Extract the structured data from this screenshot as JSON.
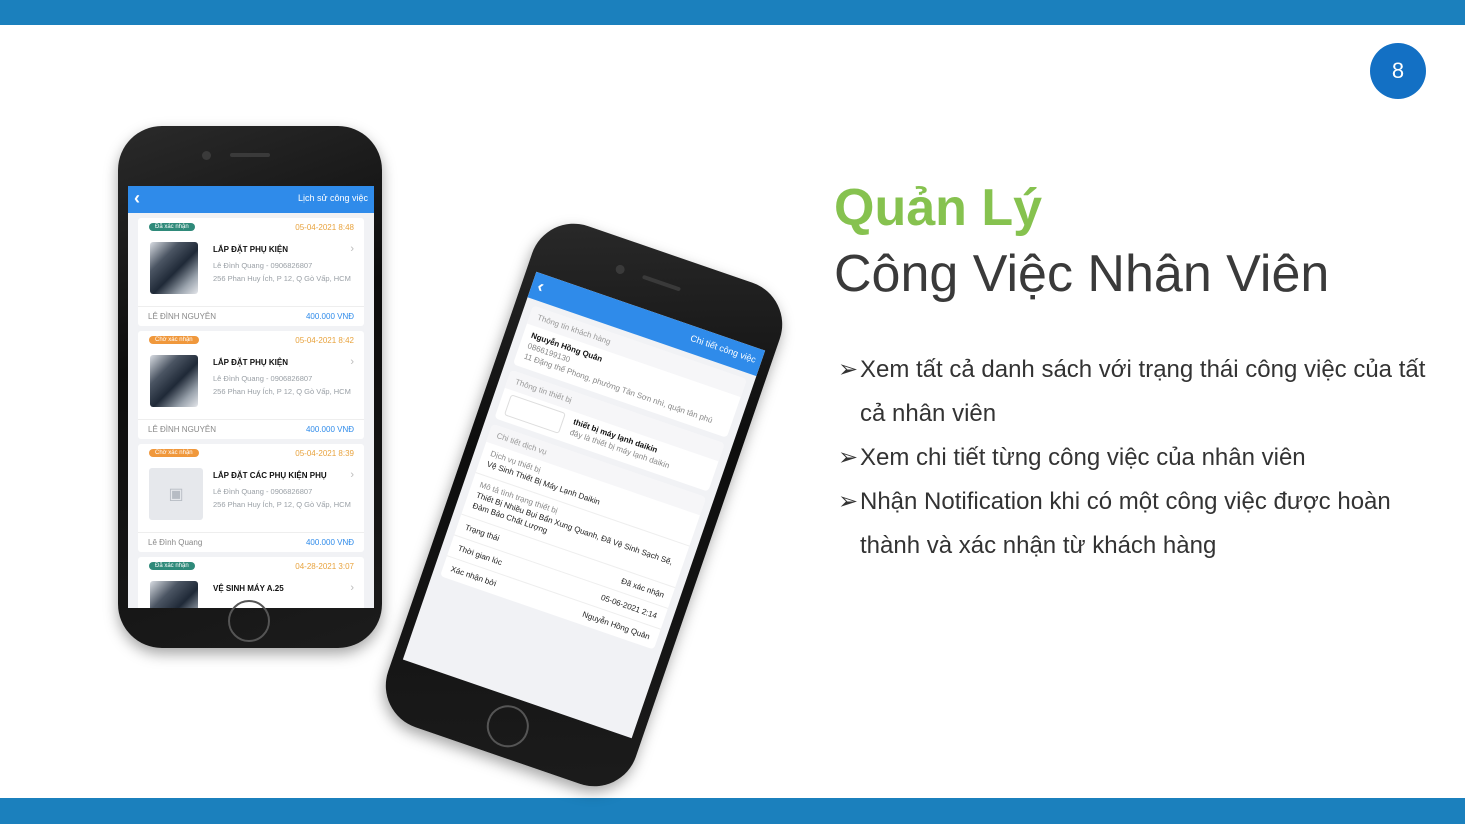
{
  "page_number": "8",
  "title": {
    "line1": "Quản Lý",
    "line2": "Công Việc Nhân Viên"
  },
  "bullets": [
    "Xem tất cả danh sách với trạng thái công việc của tất cả nhân viên",
    "Xem chi tiết từng công việc của nhân viên",
    "Nhận Notification khi có một công việc được hoàn thành và xác nhận từ khách hàng"
  ],
  "colors": {
    "band": "#1b80bd",
    "badge_circle": "#1370c4",
    "title_green": "#86c24f",
    "app_blue": "#2f8bea"
  },
  "phone1": {
    "nav_title": "Lịch sử công việc",
    "back_icon": "chevron-left-icon",
    "jobs": [
      {
        "status": "Đã xác nhận",
        "date": "05-04-2021 8:48",
        "title": "LẮP ĐẶT PHỤ KIỆN",
        "contact": "Lê Đình Quang - 0906826807",
        "address": "256 Phan Huy Ích, P 12, Q Gò Vấp, HCM",
        "employee": "LÊ ĐÌNH NGUYÊN",
        "price": "400.000 VNĐ"
      },
      {
        "status": "Chờ xác nhận",
        "date": "05-04-2021 8:42",
        "title": "LẮP ĐẶT PHỤ KIỆN",
        "contact": "Lê Đình Quang - 0906826807",
        "address": "256 Phan Huy Ích, P 12, Q Gò Vấp, HCM",
        "employee": "LÊ ĐÌNH NGUYÊN",
        "price": "400.000 VNĐ"
      },
      {
        "status": "Chờ xác nhận",
        "date": "05-04-2021 8:39",
        "title": "LẮP ĐẶT CÁC PHỤ KIỆN PHỤ",
        "contact": "Lê Đình Quang - 0906826807",
        "address": "256 Phan Huy Ích, P 12, Q Gò Vấp, HCM",
        "employee": "Lê Đình Quang",
        "price": "400.000 VNĐ"
      },
      {
        "status": "Đã xác nhận",
        "date": "04-28-2021 3:07",
        "title": "VỆ SINH MÁY A.25"
      }
    ]
  },
  "phone2": {
    "nav_title": "Chi tiết công việc",
    "customer_header": "Thông tin khách hàng",
    "customer_name": "Nguyễn Hồng Quân",
    "customer_phone": "0866199130",
    "customer_address": "11 Đặng thế Phong, phường Tân Sơn nhì, quận tân phú",
    "device_header": "Thông tin thiết bị",
    "device_name": "thiết bị máy lạnh daikin",
    "device_desc": "đây là thiết bị máy lạnh daikin",
    "service_header": "Chi tiết dịch vụ",
    "service_label": "Dịch vụ thiết bị",
    "service_value": "Vệ Sinh Thiết Bị Máy Lạnh Daikin",
    "condition_label": "Mô tả tình trạng thiết bị",
    "condition_value": "Thiết Bị Nhiều Bụi Bẩn Xung Quanh, Đã Vệ Sinh Sạch Sẽ, Đảm Bảo Chất Lượng",
    "status_label": "Trạng thái",
    "status_value": "Đã xác nhận",
    "time_label": "Thời gian lúc",
    "time_value": "05-06-2021 2:14",
    "confirmed_by_label": "Xác nhận bởi",
    "confirmed_by_value": "Nguyễn Hồng Quân"
  }
}
